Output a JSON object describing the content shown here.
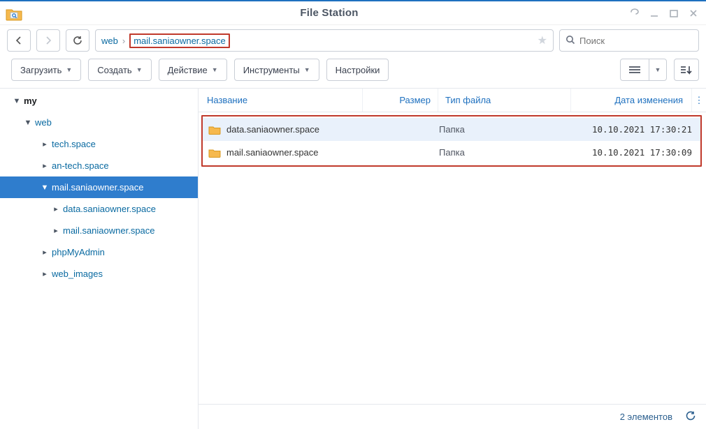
{
  "window": {
    "title": "File Station"
  },
  "nav": {
    "crumbs": [
      "web",
      "mail.saniaowner.space"
    ],
    "highlight_index": 1
  },
  "search": {
    "placeholder": "Поиск"
  },
  "toolbar": {
    "upload": "Загрузить",
    "create": "Создать",
    "action": "Действие",
    "tools": "Инструменты",
    "settings": "Настройки"
  },
  "tree": [
    {
      "label": "my",
      "level": 0,
      "twisty": "▼",
      "bold": true
    },
    {
      "label": "web",
      "level": 1,
      "twisty": "▼"
    },
    {
      "label": "tech.space",
      "level": 2,
      "twisty": "▸"
    },
    {
      "label": "an-tech.space",
      "level": 2,
      "twisty": "▸"
    },
    {
      "label": "mail.saniaowner.space",
      "level": 2,
      "twisty": "▼",
      "selected": true
    },
    {
      "label": "data.saniaowner.space",
      "level": 3,
      "twisty": "▸"
    },
    {
      "label": "mail.saniaowner.space",
      "level": 3,
      "twisty": "▸"
    },
    {
      "label": "phpMyAdmin",
      "level": 2,
      "twisty": "▸"
    },
    {
      "label": "web_images",
      "level": 2,
      "twisty": "▸"
    }
  ],
  "columns": {
    "name": "Название",
    "size": "Размер",
    "type": "Тип файла",
    "date": "Дата изменения"
  },
  "rows": [
    {
      "name": "data.saniaowner.space",
      "size": "",
      "type": "Папка",
      "date": "10.10.2021 17:30:21",
      "selected": true
    },
    {
      "name": "mail.saniaowner.space",
      "size": "",
      "type": "Папка",
      "date": "10.10.2021 17:30:09",
      "selected": false
    }
  ],
  "footer": {
    "count_text": "2 элементов"
  }
}
